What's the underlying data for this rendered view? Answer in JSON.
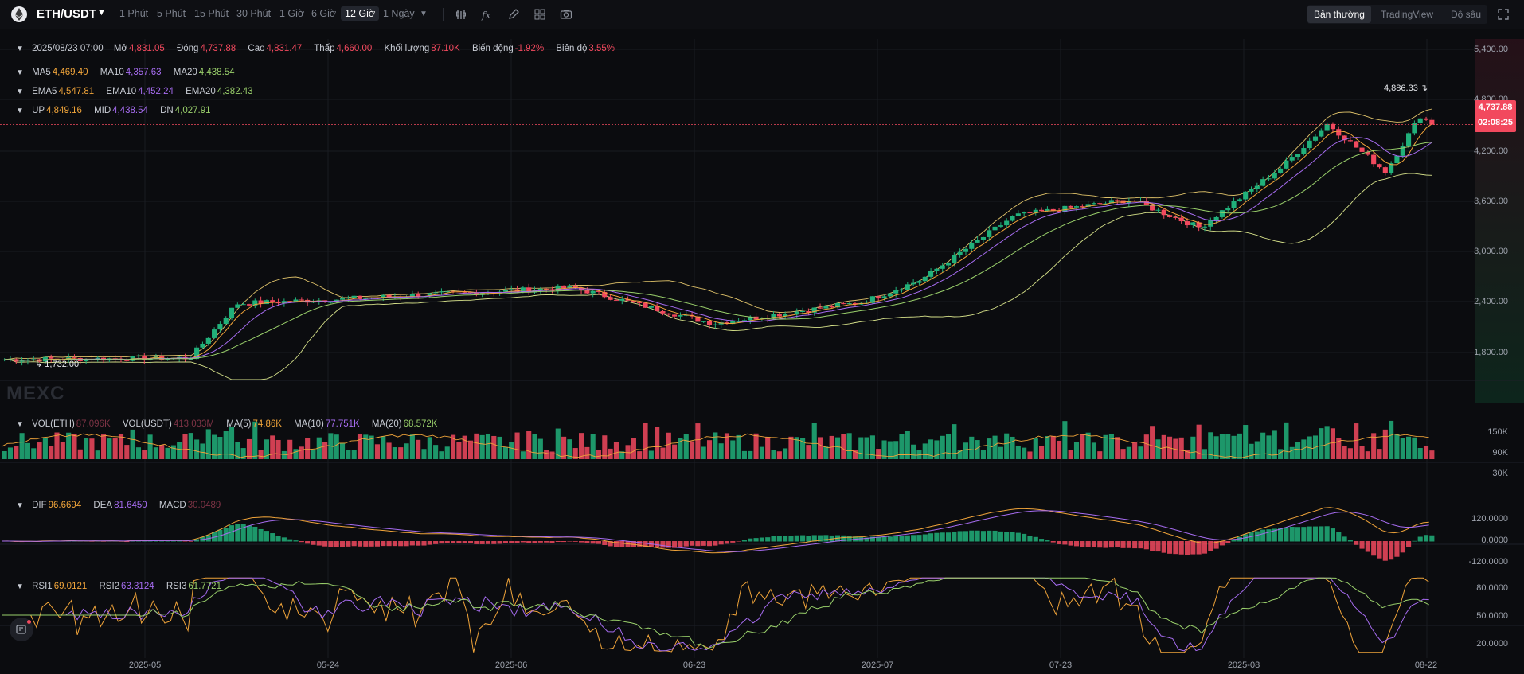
{
  "header": {
    "symbol": "ETH/USDT",
    "timeframes": [
      "1 Phút",
      "5 Phút",
      "15 Phút",
      "30 Phút",
      "1 Giờ",
      "6 Giờ",
      "12 Giờ",
      "1 Ngày"
    ],
    "active_timeframe": "12 Giờ",
    "view_modes": [
      "Bản thường",
      "TradingView",
      "Độ sâu"
    ],
    "active_view": "Bản thường"
  },
  "ohlc": {
    "date": "2025/08/23 07:00",
    "open_label": "Mở",
    "open": "4,831.05",
    "close_label": "Đóng",
    "close": "4,737.88",
    "high_label": "Cao",
    "high": "4,831.47",
    "low_label": "Thấp",
    "low": "4,660.00",
    "volume_label": "Khối lượng",
    "volume": "87.10K",
    "change_label": "Biến động",
    "change": "-1.92%",
    "amplitude_label": "Biên độ",
    "amplitude": "3.55%"
  },
  "ma": {
    "ma5_label": "MA5",
    "ma5": "4,469.40",
    "ma10_label": "MA10",
    "ma10": "4,357.63",
    "ma20_label": "MA20",
    "ma20": "4,438.54"
  },
  "ema": {
    "ema5_label": "EMA5",
    "ema5": "4,547.81",
    "ema10_label": "EMA10",
    "ema10": "4,452.24",
    "ema20_label": "EMA20",
    "ema20": "4,382.43"
  },
  "boll": {
    "up_label": "UP",
    "up": "4,849.16",
    "mid_label": "MID",
    "mid": "4,438.54",
    "dn_label": "DN",
    "dn": "4,027.91"
  },
  "price_axis": [
    "5,400.00",
    "4,800.00",
    "4,200.00",
    "3,600.00",
    "3,000.00",
    "2,400.00",
    "1,800.00"
  ],
  "last_price": {
    "price": "4,737.88",
    "countdown": "02:08:25"
  },
  "high_marker": "4,886.33",
  "low_marker": "1,732.00",
  "watermark": "MEXC",
  "volume": {
    "vol_eth_label": "VOL(ETH)",
    "vol_eth": "87.096K",
    "vol_usdt_label": "VOL(USDT)",
    "vol_usdt": "413.033M",
    "ma5_label": "MA(5)",
    "ma5": "74.86K",
    "ma10_label": "MA(10)",
    "ma10": "77.751K",
    "ma20_label": "MA(20)",
    "ma20": "68.572K",
    "axis": [
      "150K",
      "90K",
      "30K"
    ]
  },
  "macd": {
    "dif_label": "DIF",
    "dif": "96.6694",
    "dea_label": "DEA",
    "dea": "81.6450",
    "macd_label": "MACD",
    "macd": "30.0489",
    "axis": [
      "120.0000",
      "0.0000",
      "-120.0000"
    ]
  },
  "rsi": {
    "rsi1_label": "RSI1",
    "rsi1": "69.0121",
    "rsi2_label": "RSI2",
    "rsi2": "63.3124",
    "rsi3_label": "RSI3",
    "rsi3": "61.7721",
    "axis": [
      "80.0000",
      "50.0000",
      "20.0000"
    ]
  },
  "date_axis": [
    "2025-05",
    "05-24",
    "2025-06",
    "06-23",
    "2025-07",
    "07-23",
    "2025-08",
    "08-22"
  ],
  "colors": {
    "up": "#21b07a",
    "down": "#f2495e",
    "ma5": "#f0a43a",
    "ma10": "#a66cf0",
    "ma20": "#9ad06b",
    "grid": "#1a1c22"
  },
  "chart_data": {
    "type": "candlestick",
    "interval": "12 Giờ",
    "x_range": [
      "2025-04-22",
      "2025-08-23"
    ],
    "ylim": [
      1500,
      5600
    ],
    "key_points": [
      {
        "x": "2025-04-22",
        "y": 1800
      },
      {
        "x": "2025-05-08",
        "y": 1820
      },
      {
        "x": "2025-05-12",
        "y": 2500
      },
      {
        "x": "2025-05-20",
        "y": 2550
      },
      {
        "x": "2025-06-10",
        "y": 2700
      },
      {
        "x": "2025-06-22",
        "y": 2250
      },
      {
        "x": "2025-07-05",
        "y": 2520
      },
      {
        "x": "2025-07-10",
        "y": 2800
      },
      {
        "x": "2025-07-18",
        "y": 3600
      },
      {
        "x": "2025-07-28",
        "y": 3800
      },
      {
        "x": "2025-08-03",
        "y": 3450
      },
      {
        "x": "2025-08-10",
        "y": 4200
      },
      {
        "x": "2025-08-14",
        "y": 4750
      },
      {
        "x": "2025-08-19",
        "y": 4150
      },
      {
        "x": "2025-08-22",
        "y": 4850
      },
      {
        "x": "2025-08-23",
        "y": 4737.88
      }
    ]
  }
}
